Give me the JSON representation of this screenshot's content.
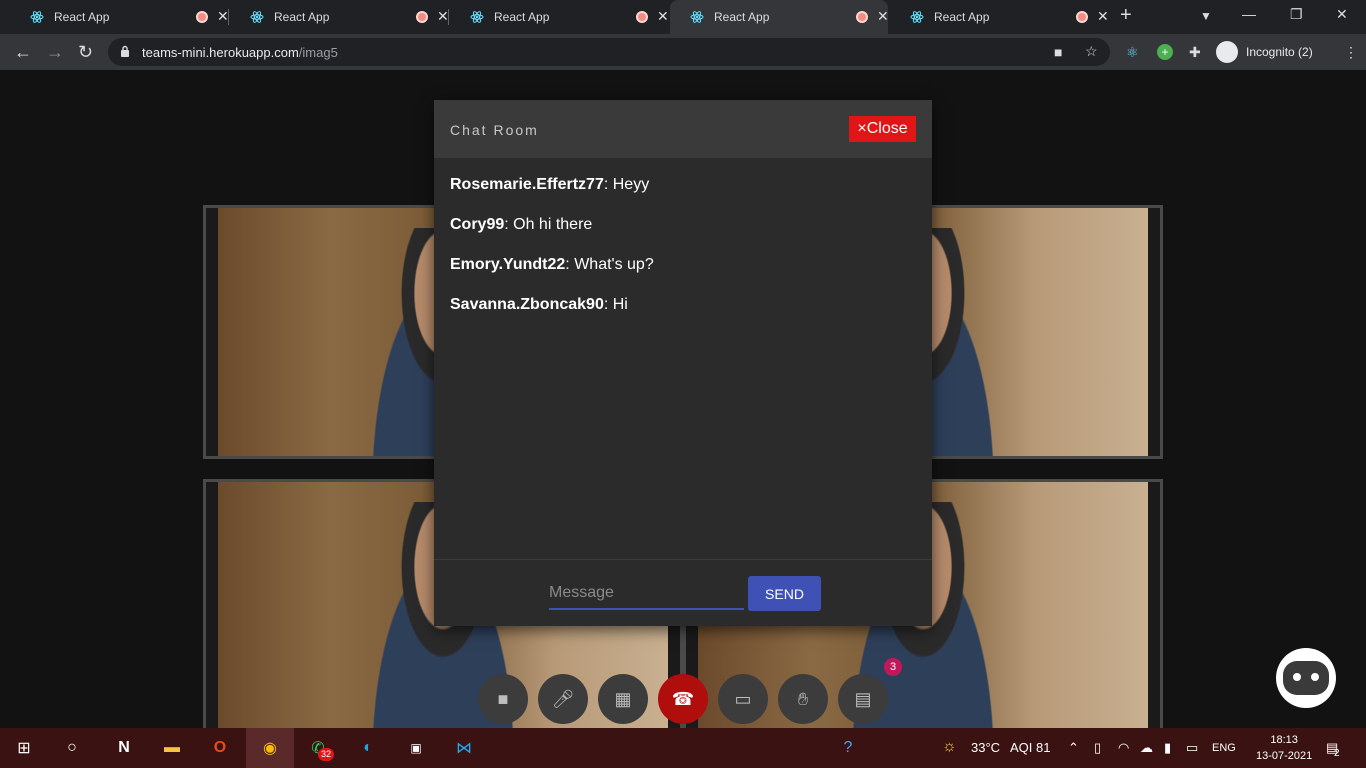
{
  "browser": {
    "tabs": [
      {
        "title": "React App"
      },
      {
        "title": "React App"
      },
      {
        "title": "React App"
      },
      {
        "title": "React App"
      },
      {
        "title": "React App"
      }
    ],
    "active_tab_index": 3,
    "url_host": "teams-mini.herokuapp.com",
    "url_path": "/imag5",
    "profile_label": "Incognito (2)"
  },
  "chat": {
    "title": "Chat Room",
    "close_label": "×Close",
    "messages": [
      {
        "user": "Rosemarie.Effertz77",
        "text": ": Heyy"
      },
      {
        "user": "Cory99",
        "text": ": Oh hi there"
      },
      {
        "user": "Emory.Yundt22",
        "text": ": What's up?"
      },
      {
        "user": "Savanna.Zboncak90",
        "text": ": Hi"
      }
    ],
    "input_placeholder": "Message",
    "send_label": "SEND"
  },
  "controls": {
    "chat_badge": "3"
  },
  "taskbar": {
    "whatsapp_badge": "32",
    "weather": "33°C",
    "aqi": "AQI 81",
    "lang": "ENG",
    "time": "18:13",
    "date": "13-07-2021",
    "notif_count": "2"
  },
  "colors": {
    "close_red": "#e01515",
    "send_blue": "#3f51b5",
    "end_call_red": "#b00d0d"
  }
}
